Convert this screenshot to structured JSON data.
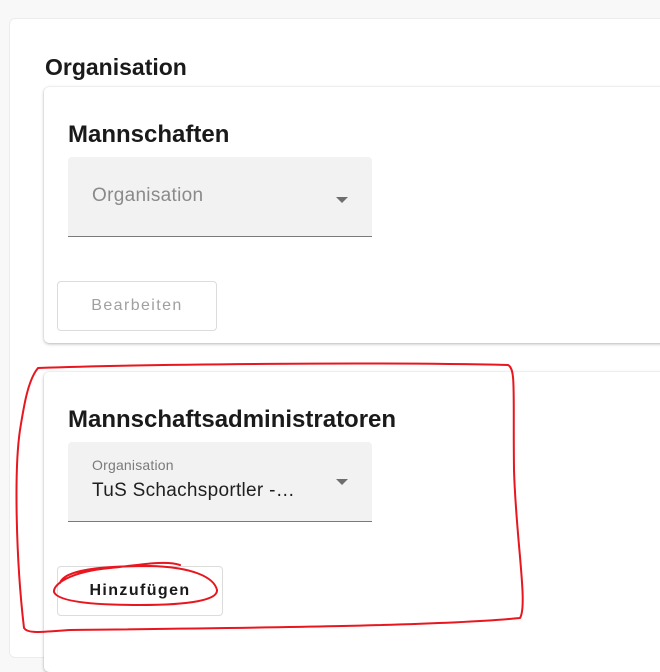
{
  "section": {
    "title": "Organisation"
  },
  "teams_card": {
    "heading": "Mannschaften",
    "select_placeholder": "Organisation",
    "edit_button_label": "Bearbeiten"
  },
  "admins_card": {
    "heading": "Mannschaftsadministratoren",
    "select_label": "Organisation",
    "select_value": "TuS Schachsportler -…",
    "add_button_label": "Hinzufügen"
  },
  "colors": {
    "annotation_stroke": "#e8161e",
    "field_background": "#f2f2f2",
    "page_background": "#f8f8f8"
  },
  "icons": {
    "dropdown": "triangle-down"
  }
}
